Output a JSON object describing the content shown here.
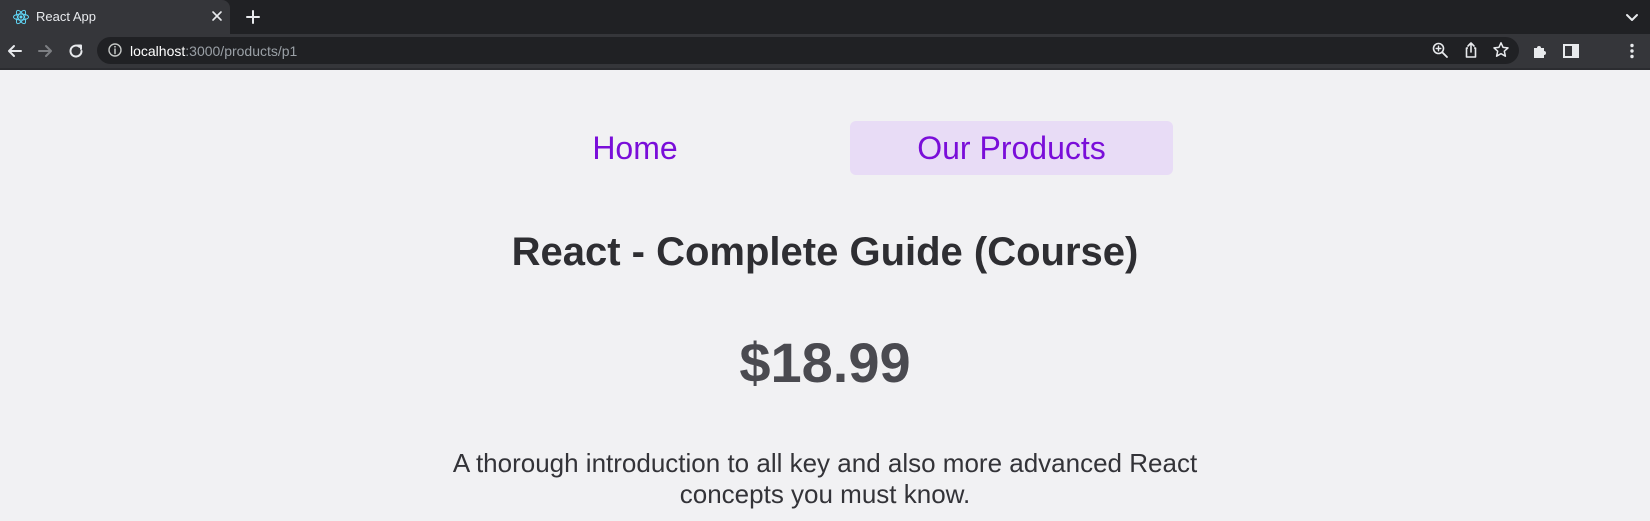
{
  "browser": {
    "tab_title": "React App",
    "url_host": "localhost",
    "url_path": ":3000/products/p1",
    "colors": {
      "tabstrip": "#202124",
      "toolbar": "#35363a",
      "omnibox": "#202124"
    }
  },
  "nav": {
    "home_label": "Home",
    "products_label": "Our Products",
    "active": "products",
    "colors": {
      "link": "#7a0ed9",
      "active_bg": "#e8dcf6"
    }
  },
  "product": {
    "title": "React - Complete Guide (Course)",
    "price": "$18.99",
    "description": "A thorough introduction to all key and also more advanced React concepts you must know."
  },
  "icons": [
    "react-favicon-icon",
    "close-icon",
    "plus-icon",
    "chevron-down-icon",
    "back-arrow-icon",
    "forward-arrow-icon",
    "reload-icon",
    "info-icon",
    "zoom-icon",
    "share-icon",
    "star-icon",
    "puzzle-icon",
    "side-panel-icon",
    "kebab-menu-icon"
  ]
}
